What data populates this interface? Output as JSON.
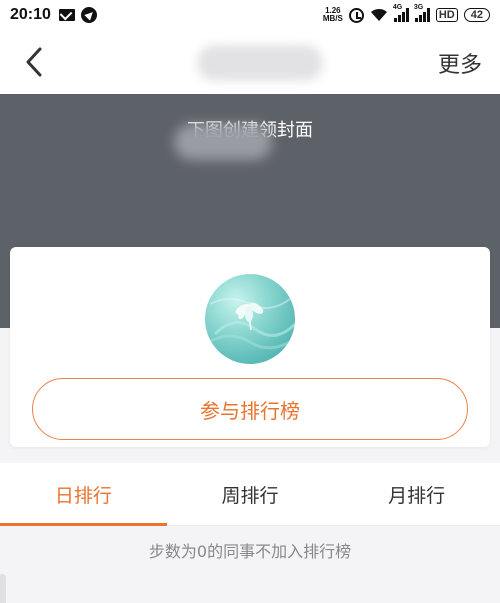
{
  "status_bar": {
    "time": "20:10",
    "net_speed_value": "1.26",
    "net_speed_unit": "MB/S",
    "sim1_tag": "4G",
    "sim2_tag": "3G",
    "hd": "HD",
    "battery": "42"
  },
  "nav": {
    "more_label": "更多"
  },
  "cover": {
    "text": "下图创建领封面"
  },
  "card": {
    "join_button_label": "参与排行榜"
  },
  "tabs": [
    {
      "label": "日排行",
      "active": true
    },
    {
      "label": "周排行",
      "active": false
    },
    {
      "label": "月排行",
      "active": false
    }
  ],
  "notice": "步数为0的同事不加入排行榜",
  "colors": {
    "accent": "#e8742f",
    "cover_bg": "#5d6168",
    "page_bg": "#f4f4f6"
  }
}
